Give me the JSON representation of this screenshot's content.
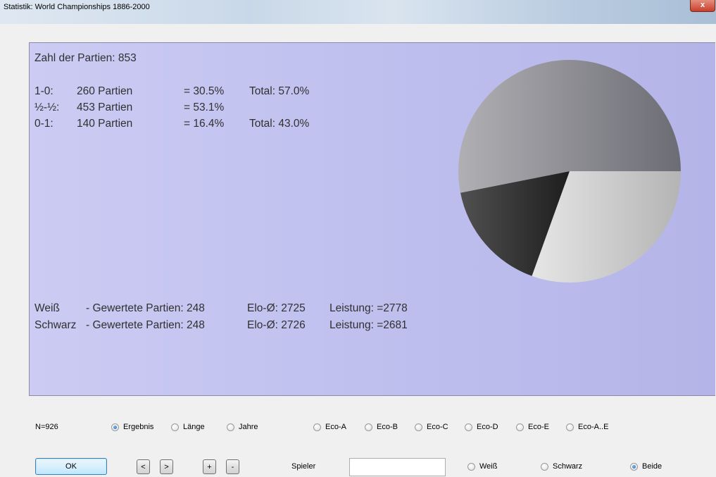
{
  "window": {
    "title": "Statistik: World Championships 1886-2000",
    "close_label": "x"
  },
  "stats": {
    "games_count_line": "Zahl der Partien: 853",
    "results": [
      {
        "label": "1-0:",
        "games": "260 Partien",
        "pct": "= 30.5%",
        "total": "Total: 57.0%"
      },
      {
        "label": "½-½:",
        "games": "453 Partien",
        "pct": "= 53.1%",
        "total": ""
      },
      {
        "label": "0-1:",
        "games": "140 Partien",
        "pct": "= 16.4%",
        "total": "Total: 43.0%"
      }
    ],
    "ratings": [
      {
        "side": "Weiß",
        "rated": "- Gewertete Partien: 248",
        "elo": "Elo-Ø: 2725",
        "performance": "Leistung: =2778"
      },
      {
        "side": "Schwarz",
        "rated": "- Gewertete Partien: 248",
        "elo": "Elo-Ø: 2726",
        "performance": "Leistung: =2681"
      }
    ]
  },
  "chart_data": {
    "type": "pie",
    "title": "",
    "slices": [
      {
        "name": "1-0",
        "value": 30.5,
        "color": "#c8c8c8"
      },
      {
        "name": "0-1",
        "value": 16.4,
        "color": "#3a3a3a"
      },
      {
        "name": "½-½",
        "value": 53.1,
        "color": "#8c8c94"
      }
    ],
    "start_angle_deg": 0,
    "direction": "clockwise"
  },
  "controls": {
    "n_label": "N=926",
    "view_options": [
      {
        "label": "Ergebnis",
        "checked": true
      },
      {
        "label": "Länge",
        "checked": false
      },
      {
        "label": "Jahre",
        "checked": false
      },
      {
        "label": "Eco-A",
        "checked": false
      },
      {
        "label": "Eco-B",
        "checked": false
      },
      {
        "label": "Eco-C",
        "checked": false
      },
      {
        "label": "Eco-D",
        "checked": false
      },
      {
        "label": "Eco-E",
        "checked": false
      },
      {
        "label": "Eco-A..E",
        "checked": false
      }
    ],
    "ok_label": "OK",
    "prev_label": "<",
    "next_label": ">",
    "plus_label": "+",
    "minus_label": "-",
    "player_label": "Spieler",
    "player_value": "",
    "color_options": [
      {
        "label": "Weiß",
        "checked": false
      },
      {
        "label": "Schwarz",
        "checked": false
      },
      {
        "label": "Beide",
        "checked": true
      }
    ]
  }
}
